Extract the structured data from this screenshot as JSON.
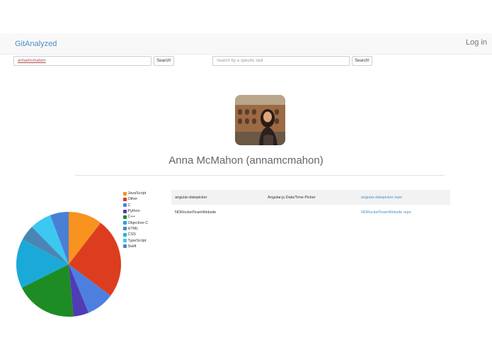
{
  "navbar": {
    "brand": "GitAnalyzed",
    "login": "Log in"
  },
  "search": {
    "user_value": "annamcmahon",
    "user_button": "Search!",
    "skill_placeholder": "Search by a specific skill",
    "skill_button": "Search!"
  },
  "profile": {
    "name": "Anna McMahon (annamcmahon)"
  },
  "legend": [
    {
      "label": "JavaScript",
      "color": "#f7931e"
    },
    {
      "label": "Other",
      "color": "#dc3d1f"
    },
    {
      "label": "C",
      "color": "#4d7fe0"
    },
    {
      "label": "Python",
      "color": "#503cb4"
    },
    {
      "label": "C++",
      "color": "#1d8c24"
    },
    {
      "label": "Objective-C",
      "color": "#1ba9d8"
    },
    {
      "label": "HTML",
      "color": "#4a86b4"
    },
    {
      "label": "CSS",
      "color": "#1eb0e0"
    },
    {
      "label": "TypeScript",
      "color": "#3cc8f0"
    },
    {
      "label": "Swift",
      "color": "#4a7fd6"
    }
  ],
  "repos": [
    {
      "name": "angular-datepicker",
      "description": "Angular.js Date/Time Picker",
      "link": "angular-datepicker repo"
    },
    {
      "name": "NDRocketTeamWebsite",
      "description": "",
      "link": "NDRocketTeamWebsite repo"
    }
  ],
  "chart_data": {
    "type": "pie",
    "labels": [
      "JavaScript",
      "Other",
      "C",
      "Python",
      "C++",
      "Objective-C",
      "HTML",
      "CSS",
      "TypeScript",
      "Swift"
    ],
    "values": [
      11,
      26,
      9,
      5,
      20,
      16,
      0,
      5,
      7,
      6
    ],
    "colors": [
      "#f7931e",
      "#dc3d1f",
      "#4d7fe0",
      "#503cb4",
      "#1d8c24",
      "#1ba9d8",
      "#4a86b4",
      "#4a86b4",
      "#3cc8f0",
      "#4a7fd6"
    ]
  }
}
